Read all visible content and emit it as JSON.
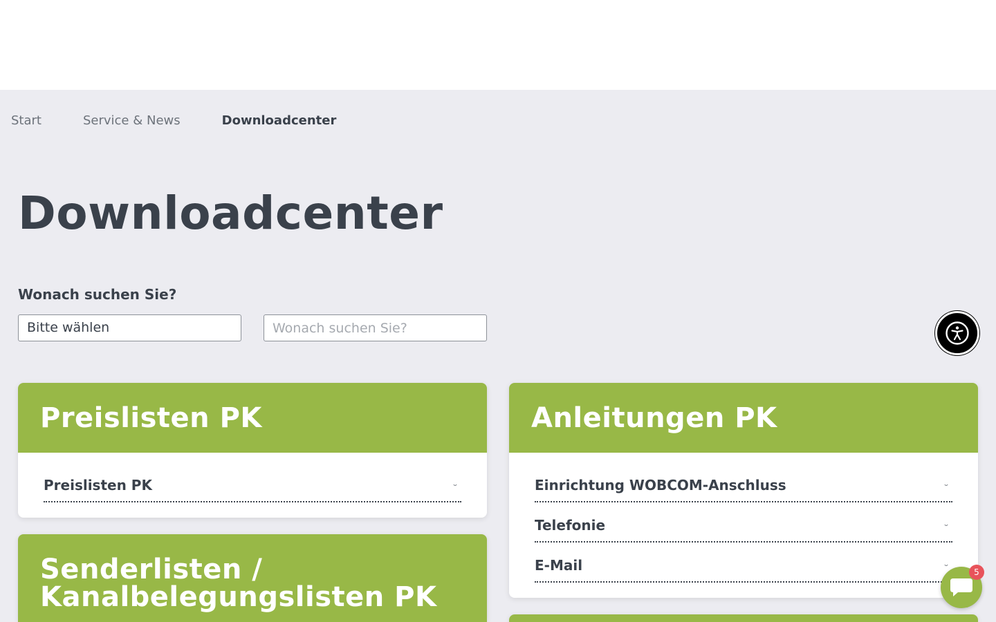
{
  "breadcrumb": {
    "items": [
      {
        "label": "Start"
      },
      {
        "label": "Service & News"
      },
      {
        "label": "Downloadcenter"
      }
    ],
    "separator": ""
  },
  "page": {
    "title": "Downloadcenter"
  },
  "search": {
    "label": "Wonach suchen Sie?",
    "select_value": "Bitte wählen",
    "input_placeholder": "Wonach suchen Sie?"
  },
  "cards": {
    "preislisten": {
      "title": "Preislisten PK",
      "items": [
        {
          "label": "Preislisten PK"
        }
      ]
    },
    "anleitungen": {
      "title": "Anleitungen PK",
      "items": [
        {
          "label": "Einrichtung WOBCOM-Anschluss"
        },
        {
          "label": "Telefonie"
        },
        {
          "label": "E-Mail"
        }
      ]
    },
    "senderlisten": {
      "title_line1": "Senderlisten /",
      "title_line2": "Kanalbelegungslisten PK"
    }
  },
  "chat": {
    "badge_count": "5"
  },
  "icons": {
    "breadcrumb_separator": "chevron-right-icon",
    "accordion": "chevron-down-icon",
    "accessibility": "accessibility-icon",
    "chat": "chat-bubble-icon"
  },
  "colors": {
    "accent_green": "#98b847",
    "background": "#ececf1",
    "text_dark": "#3a414b",
    "badge_red": "#e8535b"
  }
}
